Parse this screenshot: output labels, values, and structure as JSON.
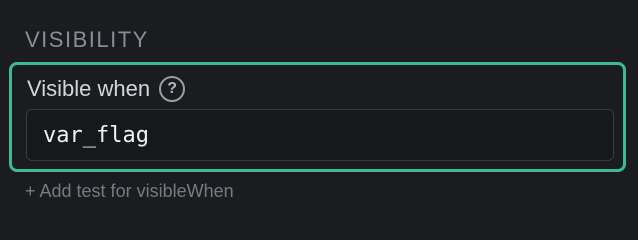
{
  "section": {
    "title": "VISIBILITY"
  },
  "field": {
    "label": "Visible when",
    "help_icon": "question-circle-icon",
    "help_glyph": "?",
    "value": "var_flag",
    "focused": true
  },
  "add_test": {
    "label": "+ Add test for visibleWhen"
  },
  "colors": {
    "background": "#1b1c20",
    "focus_border": "#3fb895",
    "label_text": "#d3d5da",
    "muted_text": "#8a8d95"
  }
}
